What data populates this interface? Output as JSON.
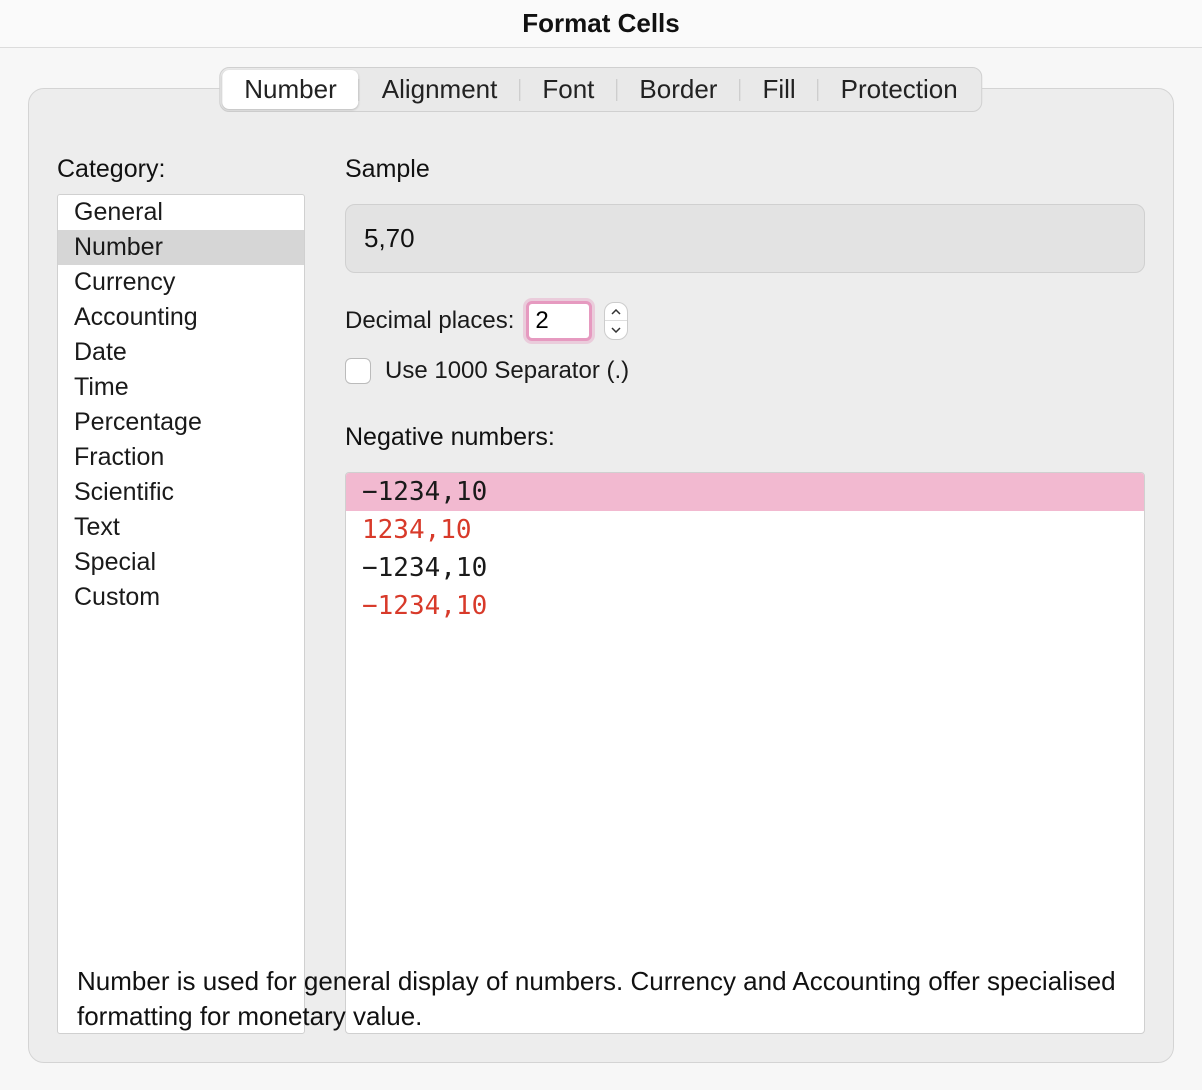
{
  "title": "Format Cells",
  "tabs": [
    {
      "label": "Number",
      "active": true
    },
    {
      "label": "Alignment",
      "active": false
    },
    {
      "label": "Font",
      "active": false
    },
    {
      "label": "Border",
      "active": false
    },
    {
      "label": "Fill",
      "active": false
    },
    {
      "label": "Protection",
      "active": false
    }
  ],
  "category_label": "Category:",
  "categories": [
    {
      "label": "General",
      "selected": false
    },
    {
      "label": "Number",
      "selected": true
    },
    {
      "label": "Currency",
      "selected": false
    },
    {
      "label": "Accounting",
      "selected": false
    },
    {
      "label": "Date",
      "selected": false
    },
    {
      "label": "Time",
      "selected": false
    },
    {
      "label": "Percentage",
      "selected": false
    },
    {
      "label": "Fraction",
      "selected": false
    },
    {
      "label": "Scientific",
      "selected": false
    },
    {
      "label": "Text",
      "selected": false
    },
    {
      "label": "Special",
      "selected": false
    },
    {
      "label": "Custom",
      "selected": false
    }
  ],
  "sample_label": "Sample",
  "sample_value": "5,70",
  "decimal_label": "Decimal places:",
  "decimal_value": "2",
  "separator_label": "Use 1000 Separator (.)",
  "separator_checked": false,
  "negative_label": "Negative numbers:",
  "negative_options": [
    {
      "text": "−1234,10",
      "color": "black",
      "selected": true
    },
    {
      "text": "1234,10",
      "color": "red",
      "selected": false
    },
    {
      "text": "−1234,10",
      "color": "black",
      "selected": false
    },
    {
      "text": "−1234,10",
      "color": "red",
      "selected": false
    }
  ],
  "description": "Number is used for general display of numbers.  Currency and Accounting offer specialised formatting for monetary value."
}
